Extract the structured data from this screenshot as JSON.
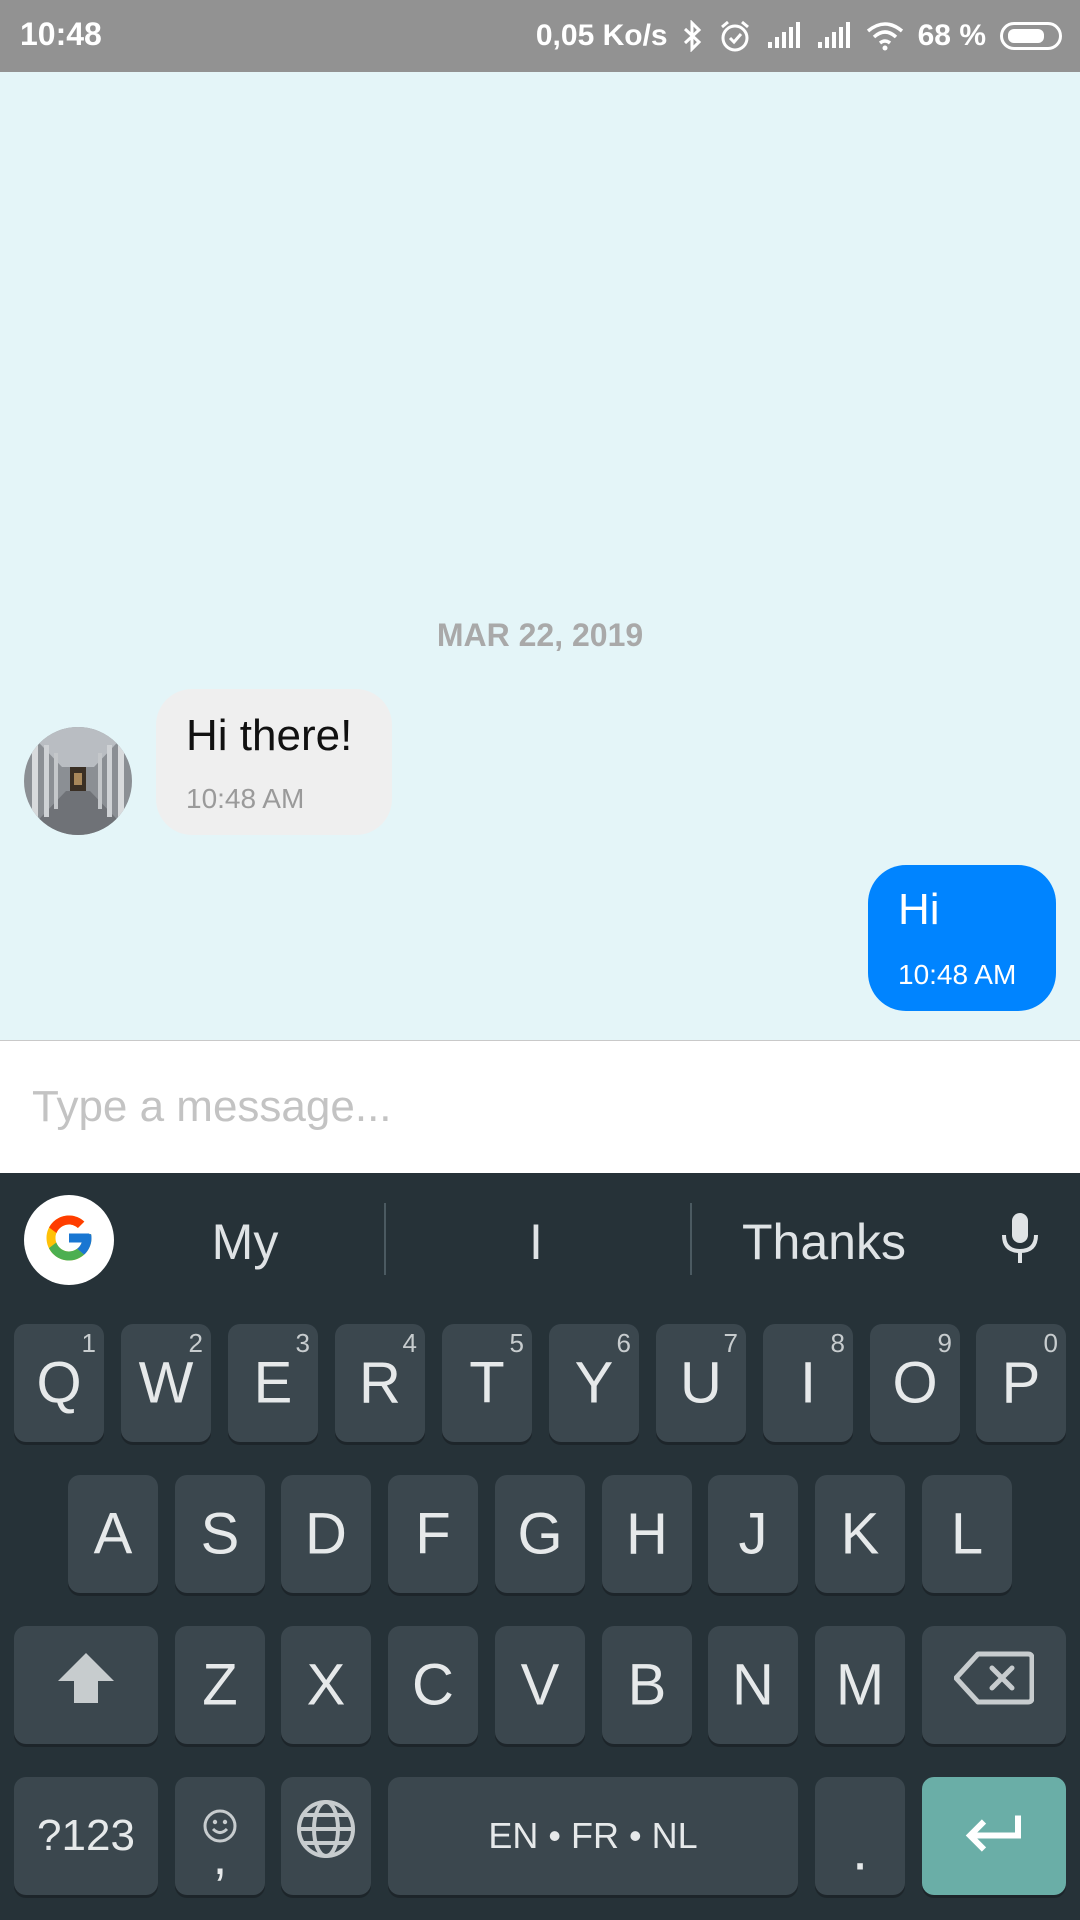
{
  "status_bar": {
    "time": "10:48",
    "net_speed": "0,05 Ko/s",
    "battery_pct": "68 %",
    "icons": [
      "bluetooth-icon",
      "alarm-icon",
      "signal-icon",
      "signal-icon",
      "wifi-icon",
      "battery-icon"
    ]
  },
  "chat": {
    "date_separator": "MAR 22, 2019",
    "messages": [
      {
        "direction": "incoming",
        "text": "Hi there!",
        "time": "10:48 AM"
      },
      {
        "direction": "outgoing",
        "text": "Hi",
        "time": "10:48 AM"
      }
    ]
  },
  "composer": {
    "placeholder": "Type a message..."
  },
  "keyboard": {
    "suggestions": [
      "My",
      "I",
      "Thanks"
    ],
    "row1": [
      {
        "key": "Q",
        "num": "1"
      },
      {
        "key": "W",
        "num": "2"
      },
      {
        "key": "E",
        "num": "3"
      },
      {
        "key": "R",
        "num": "4"
      },
      {
        "key": "T",
        "num": "5"
      },
      {
        "key": "Y",
        "num": "6"
      },
      {
        "key": "U",
        "num": "7"
      },
      {
        "key": "I",
        "num": "8"
      },
      {
        "key": "O",
        "num": "9"
      },
      {
        "key": "P",
        "num": "0"
      }
    ],
    "row2": [
      "A",
      "S",
      "D",
      "F",
      "G",
      "H",
      "J",
      "K",
      "L"
    ],
    "row3": [
      "Z",
      "X",
      "C",
      "V",
      "B",
      "N",
      "M"
    ],
    "symbols_label": "?123",
    "emoji_comma": ",",
    "space_label": "EN • FR • NL",
    "period_label": "."
  },
  "colors": {
    "outgoing_bubble": "#0084ff",
    "incoming_bubble": "#efefef",
    "chat_background": "#e4f5f8",
    "keyboard_background": "#263238",
    "enter_key": "#6aaea7"
  }
}
